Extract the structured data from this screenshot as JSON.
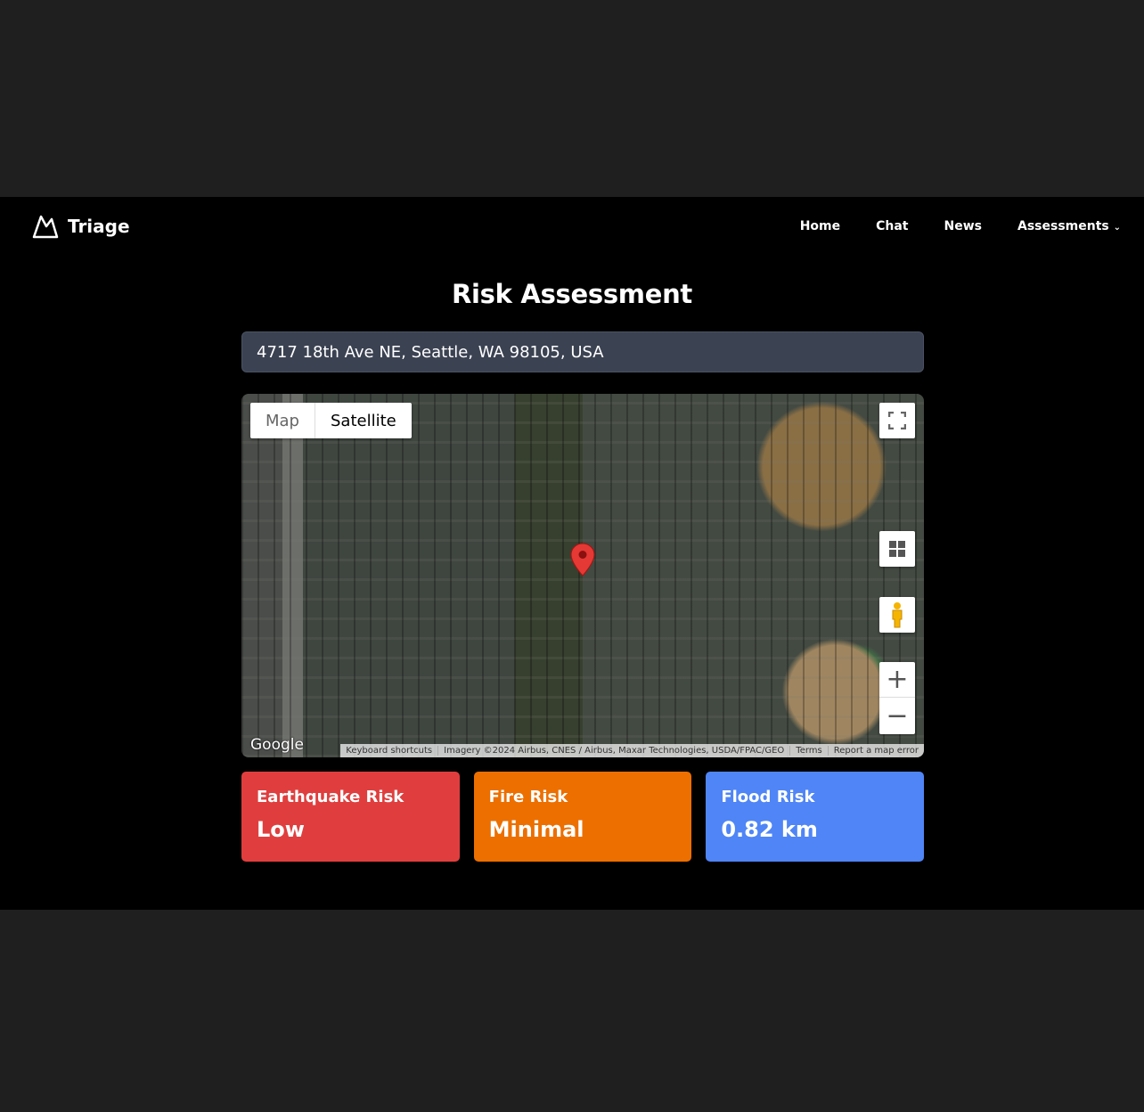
{
  "nav": {
    "brand": "Triage",
    "links": [
      "Home",
      "Chat",
      "News",
      "Assessments"
    ]
  },
  "page": {
    "title": "Risk Assessment",
    "address": "4717 18th Ave NE, Seattle, WA 98105, USA"
  },
  "map": {
    "types": [
      "Map",
      "Satellite"
    ],
    "selected": "Satellite",
    "logo": "Google",
    "attribution": [
      "Keyboard shortcuts",
      "Imagery ©2024 Airbus, CNES / Airbus, Maxar Technologies, USDA/FPAC/GEO",
      "Terms",
      "Report a map error"
    ],
    "icons": [
      "fullscreen-icon",
      "layers-icon",
      "pegman-icon",
      "zoom-in-icon",
      "zoom-out-icon",
      "map-pin-icon"
    ]
  },
  "cards": [
    {
      "title": "Earthquake Risk",
      "value": "Low",
      "color": "#e03e3e"
    },
    {
      "title": "Fire Risk",
      "value": "Minimal",
      "color": "#ec6f00"
    },
    {
      "title": "Flood Risk",
      "value": "0.82 km",
      "color": "#4f85f6"
    }
  ]
}
